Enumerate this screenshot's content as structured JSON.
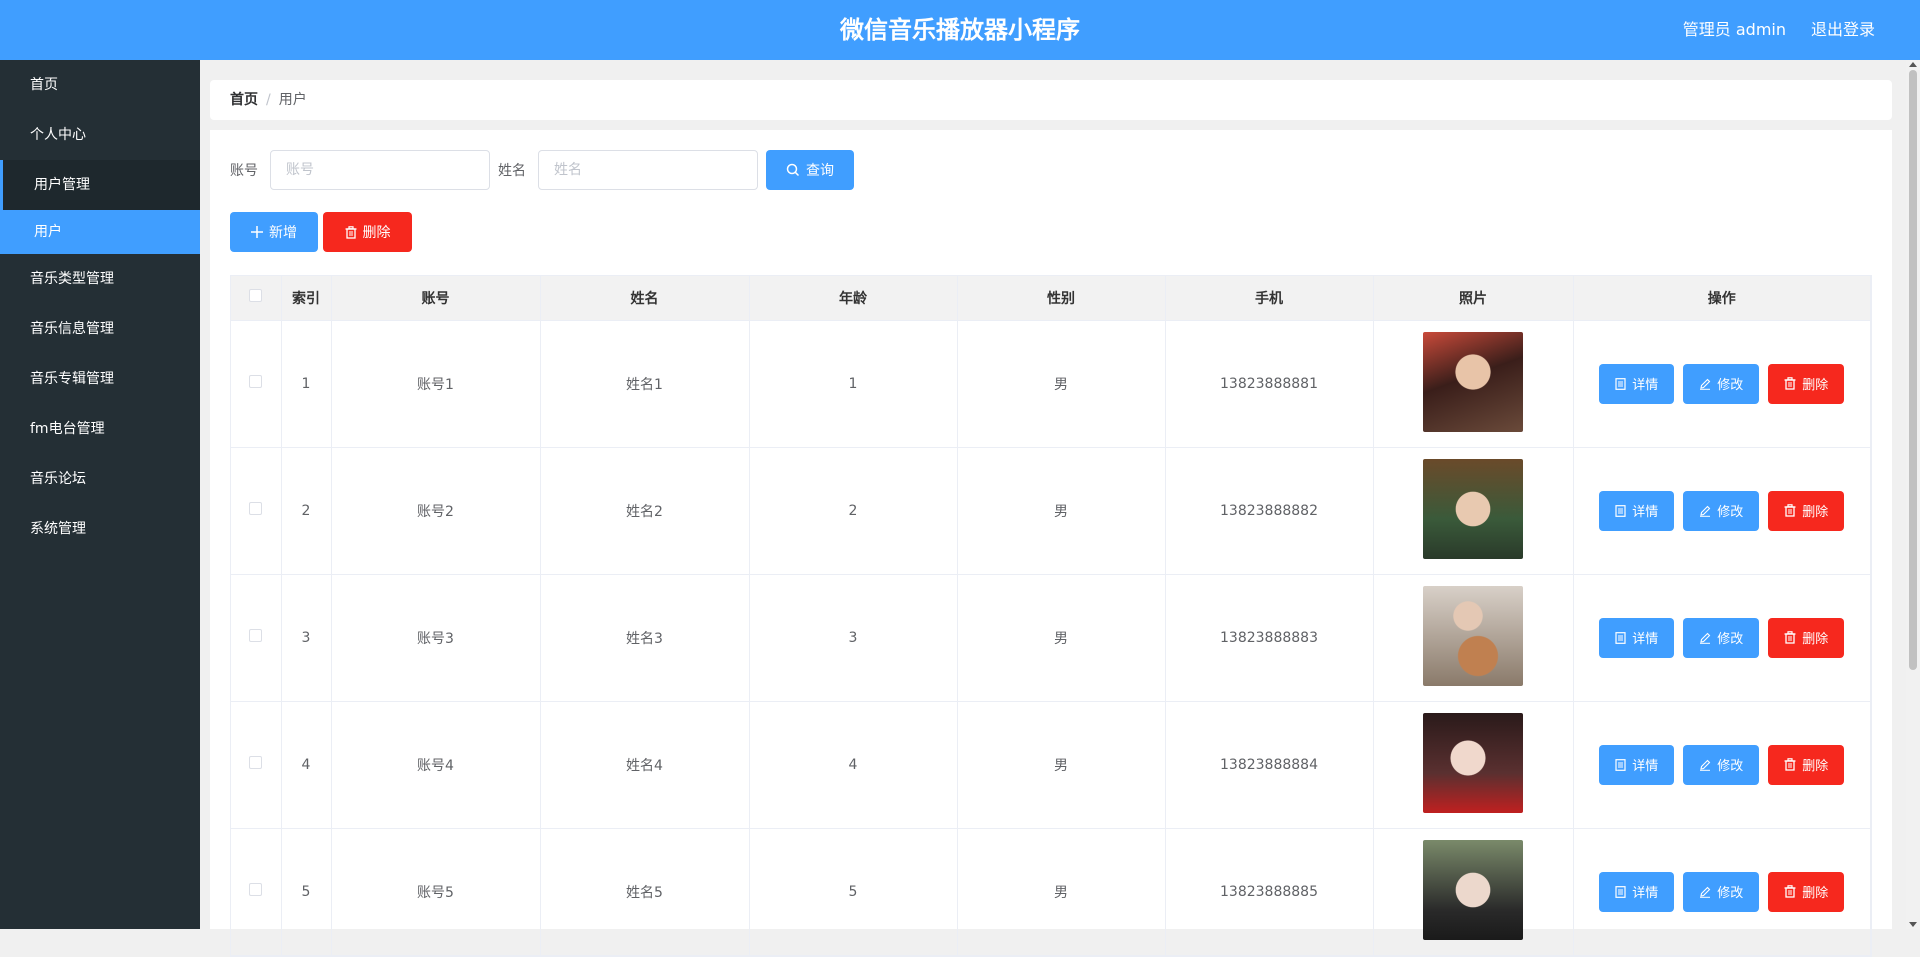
{
  "header": {
    "title": "微信音乐播放器小程序",
    "user_label": "管理员 admin",
    "logout_label": "退出登录"
  },
  "sidebar": {
    "items": [
      {
        "label": "首页"
      },
      {
        "label": "个人中心"
      },
      {
        "label": "用户管理"
      },
      {
        "label": "用户"
      },
      {
        "label": "音乐类型管理"
      },
      {
        "label": "音乐信息管理"
      },
      {
        "label": "音乐专辑管理"
      },
      {
        "label": "fm电台管理"
      },
      {
        "label": "音乐论坛"
      },
      {
        "label": "系统管理"
      }
    ]
  },
  "breadcrumb": {
    "home": "首页",
    "separator": "/",
    "current": "用户"
  },
  "search": {
    "account_label": "账号",
    "account_placeholder": "账号",
    "name_label": "姓名",
    "name_placeholder": "姓名",
    "query_label": "查询"
  },
  "actions": {
    "add_label": "新增",
    "delete_label": "删除"
  },
  "table": {
    "headers": [
      "索引",
      "账号",
      "姓名",
      "年龄",
      "性别",
      "手机",
      "照片",
      "操作"
    ],
    "rows": [
      {
        "index": "1",
        "account": "账号1",
        "name": "姓名1",
        "age": "1",
        "gender": "男",
        "phone": "13823888881"
      },
      {
        "index": "2",
        "account": "账号2",
        "name": "姓名2",
        "age": "2",
        "gender": "男",
        "phone": "13823888882"
      },
      {
        "index": "3",
        "account": "账号3",
        "name": "姓名3",
        "age": "3",
        "gender": "男",
        "phone": "13823888883"
      },
      {
        "index": "4",
        "account": "账号4",
        "name": "姓名4",
        "age": "4",
        "gender": "男",
        "phone": "13823888884"
      },
      {
        "index": "5",
        "account": "账号5",
        "name": "姓名5",
        "age": "5",
        "gender": "男",
        "phone": "13823888885"
      }
    ],
    "op_detail": "详情",
    "op_edit": "修改",
    "op_delete": "删除"
  },
  "colors": {
    "primary": "#409eff",
    "danger": "#f6281e",
    "sidebar_bg": "#242f35"
  },
  "icons": {
    "search": "search-icon",
    "add": "plus-icon",
    "delete": "trash-icon",
    "detail": "document-icon",
    "edit": "pencil-icon"
  }
}
